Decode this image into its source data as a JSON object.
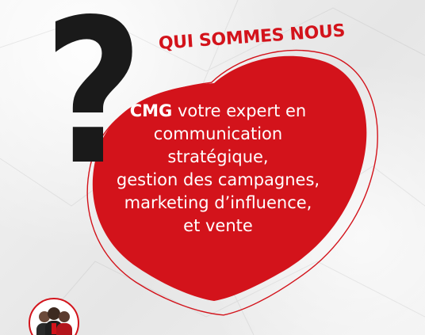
{
  "title": "QUI SOMMES NOUS",
  "question_mark": "?",
  "body": {
    "brand": "CMG",
    "line1_rest": " votre expert en",
    "line2": "communication",
    "line3": "stratégique,",
    "line4": "gestion des campagnes,",
    "line5": "marketing d’influence,",
    "line6": "et vente"
  },
  "colors": {
    "accent": "#d3131b",
    "dark": "#1a1a1a",
    "background": "#ececec"
  },
  "icons": {
    "avatar": "team-avatar-icon"
  }
}
